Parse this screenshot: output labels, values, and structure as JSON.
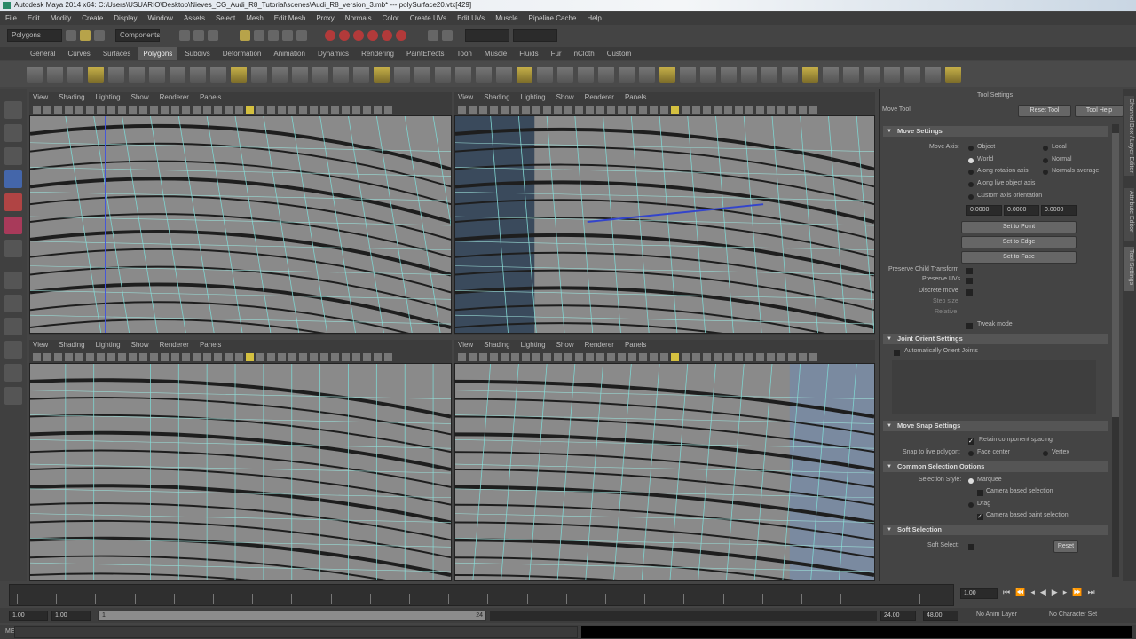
{
  "window": {
    "title": "Autodesk Maya 2014 x64: C:\\Users\\USUARIO\\Desktop\\Nieves_CG_Audi_R8_Tutorial\\scenes\\Audi_R8_version_3.mb* --- polySurface20.vtx[429]"
  },
  "menubar": [
    "File",
    "Edit",
    "Modify",
    "Create",
    "Display",
    "Window",
    "Assets",
    "Select",
    "Mesh",
    "Edit Mesh",
    "Proxy",
    "Normals",
    "Color",
    "Create UVs",
    "Edit UVs",
    "Muscle",
    "Pipeline Cache",
    "Help"
  ],
  "status": {
    "mode": "Polygons",
    "components": "Components"
  },
  "shelf_tabs": [
    "General",
    "Curves",
    "Surfaces",
    "Polygons",
    "Subdivs",
    "Deformation",
    "Animation",
    "Dynamics",
    "Rendering",
    "PaintEffects",
    "Toon",
    "Muscle",
    "Fluids",
    "Fur",
    "nCloth",
    "Custom"
  ],
  "shelf_active": "Polygons",
  "panel_menu": [
    "View",
    "Shading",
    "Lighting",
    "Show",
    "Renderer",
    "Panels"
  ],
  "tool_settings": {
    "header": "Tool Settings",
    "tool_name": "Move Tool",
    "reset": "Reset Tool",
    "tool_help": "Tool Help",
    "move_settings": "Move Settings",
    "move_axis": "Move Axis:",
    "axis_options": [
      "Object",
      "Local",
      "World",
      "Normal",
      "Along rotation axis",
      "Normals average",
      "Along live object axis",
      "Custom axis orientation"
    ],
    "axis_values": [
      "0.0000",
      "0.0000",
      "0.0000"
    ],
    "set_buttons": [
      "Set to Point",
      "Set to Edge",
      "Set to Face"
    ],
    "checks": [
      "Preserve Child Transform",
      "Preserve UVs",
      "Discrete move",
      "Step size",
      "Relative",
      "Tweak mode"
    ],
    "joint_orient": "Joint Orient Settings",
    "auto_orient": "Automatically Orient Joints",
    "snap": "Move Snap Settings",
    "retain": "Retain component spacing",
    "snap_live": "Snap to live polygon:",
    "face_center": "Face center",
    "vertex": "Vertex",
    "common": "Common Selection Options",
    "sel_style": "Selection Style:",
    "marquee": "Marquee",
    "cam_based": "Camera based selection",
    "drag": "Drag",
    "cam_paint": "Camera based paint selection",
    "soft": "Soft Selection",
    "soft_select": "Soft Select:",
    "reset_soft": "Reset"
  },
  "side_tabs": [
    "Channel Box / Layer Editor",
    "Attribute Editor",
    "Tool Settings"
  ],
  "time": {
    "current": "1.00",
    "start": "1.00",
    "start2": "1.00",
    "range_label": "1",
    "range_end_label": "24",
    "end": "24.00",
    "end2": "48.00",
    "anim_layer": "No Anim Layer",
    "char_set": "No Character Set",
    "mel": "MEL"
  }
}
